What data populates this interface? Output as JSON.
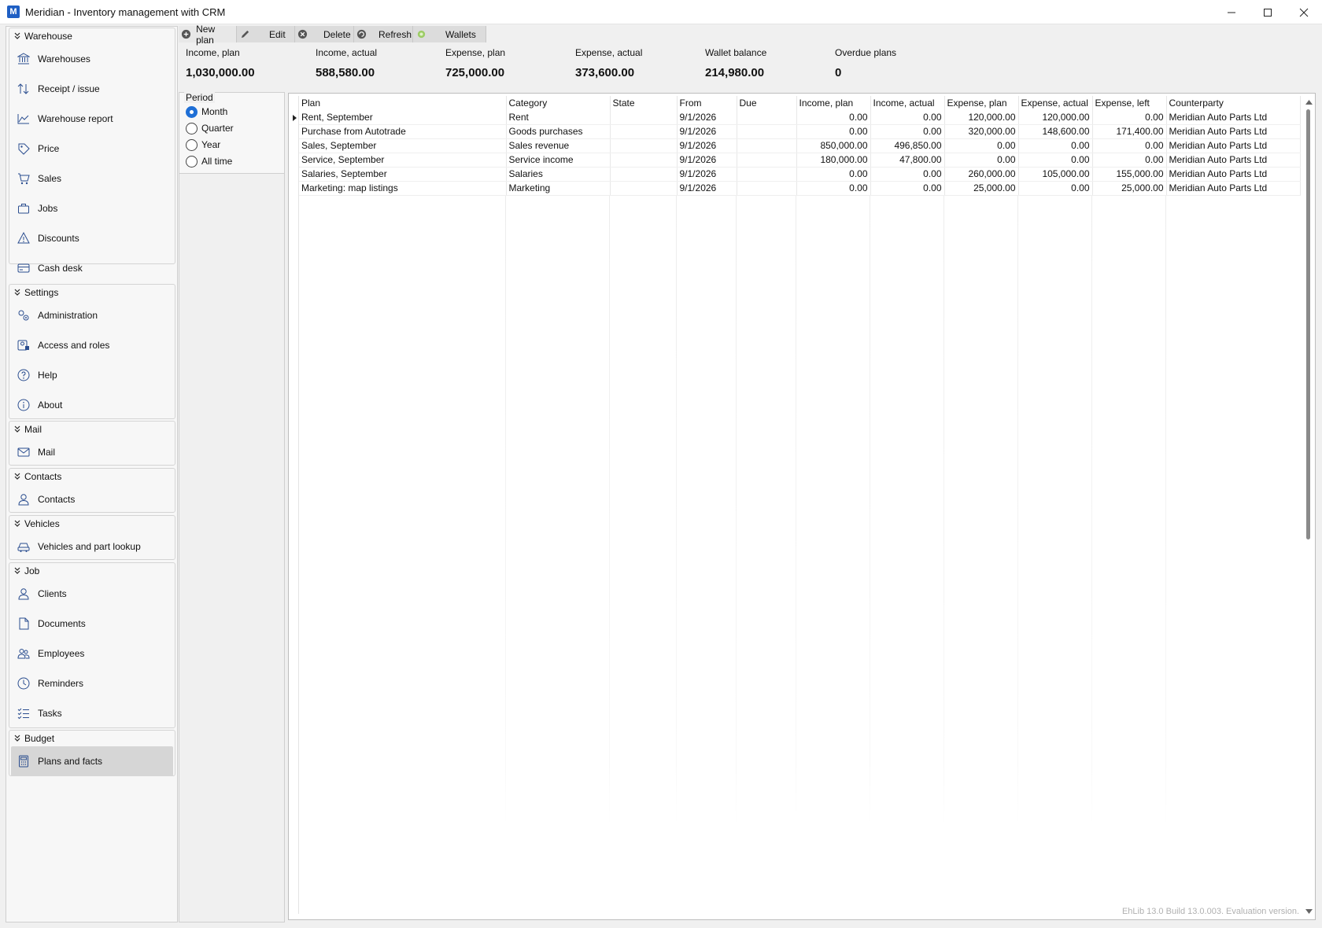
{
  "window": {
    "title": "Meridian - Inventory management with CRM",
    "icon_letter": "M"
  },
  "sidebar": {
    "groups": [
      {
        "title": "Warehouse",
        "items": [
          {
            "label": "Warehouses",
            "icon": "bank-icon"
          },
          {
            "label": "Receipt / issue",
            "icon": "arrows-updown-icon"
          },
          {
            "label": "Warehouse report",
            "icon": "area-chart-icon"
          },
          {
            "label": "Price",
            "icon": "tag-icon"
          },
          {
            "label": "Sales",
            "icon": "cart-icon"
          },
          {
            "label": "Jobs",
            "icon": "briefcase-icon"
          },
          {
            "label": "Discounts",
            "icon": "warning-icon"
          },
          {
            "label": "Cash desk",
            "icon": "card-icon"
          }
        ]
      },
      {
        "title": "Settings",
        "items": [
          {
            "label": "Administration",
            "icon": "gears-icon"
          },
          {
            "label": "Access and roles",
            "icon": "user-lock-icon"
          },
          {
            "label": "Help",
            "icon": "question-icon"
          },
          {
            "label": "About",
            "icon": "info-icon"
          }
        ]
      },
      {
        "title": "Mail",
        "items": [
          {
            "label": "Mail",
            "icon": "envelope-icon"
          }
        ]
      },
      {
        "title": "Contacts",
        "items": [
          {
            "label": "Contacts",
            "icon": "person-icon"
          }
        ]
      },
      {
        "title": "Vehicles",
        "items": [
          {
            "label": "Vehicles and part lookup",
            "icon": "car-icon"
          }
        ]
      },
      {
        "title": "Job",
        "items": [
          {
            "label": "Clients",
            "icon": "person-icon"
          },
          {
            "label": "Documents",
            "icon": "document-icon"
          },
          {
            "label": "Employees",
            "icon": "people-icon"
          },
          {
            "label": "Reminders",
            "icon": "clock-icon"
          },
          {
            "label": "Tasks",
            "icon": "checklist-icon"
          }
        ]
      },
      {
        "title": "Budget",
        "items": [
          {
            "label": "Plans and facts",
            "icon": "calculator-icon",
            "active": true
          }
        ]
      }
    ]
  },
  "toolbar": {
    "new_plan": "New plan",
    "edit": "Edit",
    "delete": "Delete",
    "refresh": "Refresh",
    "wallets": "Wallets"
  },
  "summary": {
    "income_plan": {
      "label": "Income, plan",
      "value": "1,030,000.00"
    },
    "income_actual": {
      "label": "Income, actual",
      "value": "588,580.00"
    },
    "expense_plan": {
      "label": "Expense, plan",
      "value": "725,000.00"
    },
    "expense_actual": {
      "label": "Expense, actual",
      "value": "373,600.00"
    },
    "wallet_balance": {
      "label": "Wallet balance",
      "value": "214,980.00"
    },
    "overdue_plans": {
      "label": "Overdue plans",
      "value": "0"
    }
  },
  "period": {
    "legend": "Period",
    "options": [
      "Month",
      "Quarter",
      "Year",
      "All time"
    ],
    "selected": "Month"
  },
  "grid": {
    "columns": [
      "Plan",
      "Category",
      "State",
      "From",
      "Due",
      "Income, plan",
      "Income, actual",
      "Expense, plan",
      "Expense, actual",
      "Expense, left",
      "Counterparty"
    ],
    "rows": [
      [
        "Rent, September",
        "Rent",
        "",
        "9/1/2026",
        "",
        "0.00",
        "0.00",
        "120,000.00",
        "120,000.00",
        "0.00",
        "Meridian Auto Parts Ltd"
      ],
      [
        "Purchase from Autotrade",
        "Goods purchases",
        "",
        "9/1/2026",
        "",
        "0.00",
        "0.00",
        "320,000.00",
        "148,600.00",
        "171,400.00",
        "Meridian Auto Parts Ltd"
      ],
      [
        "Sales, September",
        "Sales revenue",
        "",
        "9/1/2026",
        "",
        "850,000.00",
        "496,850.00",
        "0.00",
        "0.00",
        "0.00",
        "Meridian Auto Parts Ltd"
      ],
      [
        "Service, September",
        "Service income",
        "",
        "9/1/2026",
        "",
        "180,000.00",
        "47,800.00",
        "0.00",
        "0.00",
        "0.00",
        "Meridian Auto Parts Ltd"
      ],
      [
        "Salaries, September",
        "Salaries",
        "",
        "9/1/2026",
        "",
        "0.00",
        "0.00",
        "260,000.00",
        "105,000.00",
        "155,000.00",
        "Meridian Auto Parts Ltd"
      ],
      [
        "Marketing: map listings",
        "Marketing",
        "",
        "9/1/2026",
        "",
        "0.00",
        "0.00",
        "25,000.00",
        "0.00",
        "25,000.00",
        "Meridian Auto Parts Ltd"
      ]
    ]
  },
  "watermark": "EhLib 13.0 Build 13.0.003. Evaluation version.",
  "colors": {
    "accent": "#1f6fd6",
    "active_item": "#d6d6d6"
  }
}
